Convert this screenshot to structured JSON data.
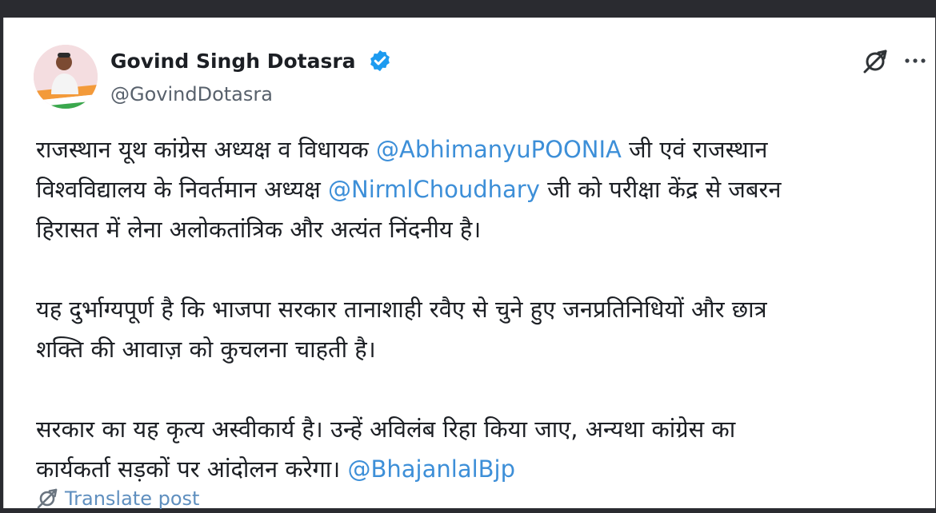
{
  "post": {
    "author_name": "Govind Singh Dotasra",
    "author_handle": "@GovindDotasra",
    "paragraphs": [
      {
        "lines": [
          [
            {
              "text": "राजस्थान यूथ कांग्रेस अध्यक्ष व विधायक ",
              "mention": false
            },
            {
              "text": "@AbhimanyuPOONIA",
              "mention": true
            },
            {
              "text": " जी एवं राजस्थान",
              "mention": false
            }
          ],
          [
            {
              "text": "विश्वविद्यालय के निवर्तमान अध्यक्ष ",
              "mention": false
            },
            {
              "text": "@NirmlChoudhary",
              "mention": true
            },
            {
              "text": " जी को परीक्षा केंद्र से जबरन",
              "mention": false
            }
          ],
          [
            {
              "text": "हिरासत में लेना अलोकतांत्रिक और अत्यंत निंदनीय है।",
              "mention": false
            }
          ]
        ]
      },
      {
        "lines": [
          [
            {
              "text": "यह दुर्भाग्यपूर्ण है कि भाजपा सरकार तानाशाही रवैए से चुने हुए जनप्रतिनिधियों और छात्र",
              "mention": false
            }
          ],
          [
            {
              "text": "शक्ति की आवाज़ को कुचलना चाहती है।",
              "mention": false
            }
          ]
        ]
      },
      {
        "lines": [
          [
            {
              "text": "सरकार का यह कृत्य अस्वीकार्य है। उन्हें अविलंब रिहा किया जाए, अन्यथा कांग्रेस का",
              "mention": false
            }
          ],
          [
            {
              "text": "कार्यकर्ता सड़कों पर आंदोलन करेगा। ",
              "mention": false
            },
            {
              "text": "@BhajanlalBjp",
              "mention": true
            }
          ]
        ]
      }
    ],
    "translate_label": "Translate post"
  },
  "icons": {
    "verified": "verified-badge-icon",
    "grok": "grok-icon",
    "more": "more-options-icon",
    "translate": "translate-icon"
  },
  "colors": {
    "text": "#1c1f24",
    "secondary_text": "#58616c",
    "mention": "#3d8fd8",
    "translate": "#5f8fbf",
    "verified": "#1d9bf0",
    "background_outer": "#2a2b30",
    "card_background": "#ffffff"
  }
}
